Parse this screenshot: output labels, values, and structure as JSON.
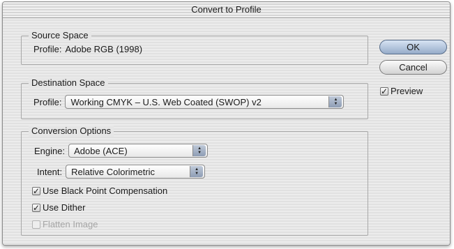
{
  "dialog": {
    "title": "Convert to Profile"
  },
  "source": {
    "title": "Source Space",
    "profile_label": "Profile:",
    "profile_value": "Adobe RGB (1998)"
  },
  "destination": {
    "title": "Destination Space",
    "profile_label": "Profile:",
    "profile_value": "Working CMYK – U.S. Web Coated (SWOP) v2"
  },
  "conversion": {
    "title": "Conversion Options",
    "engine_label": "Engine:",
    "engine_value": "Adobe (ACE)",
    "intent_label": "Intent:",
    "intent_value": "Relative Colorimetric",
    "black_point_label": "Use Black Point Compensation",
    "black_point_checked": true,
    "dither_label": "Use Dither",
    "dither_checked": true,
    "flatten_label": "Flatten Image",
    "flatten_checked": false,
    "flatten_enabled": false
  },
  "buttons": {
    "ok": "OK",
    "cancel": "Cancel"
  },
  "preview": {
    "label": "Preview",
    "checked": true
  },
  "icons": {
    "check": "✓",
    "popup_arrows": "updown-arrows-icon"
  },
  "colors": {
    "default_button": "#96acc9",
    "dialog_bg": "#e4e4e4"
  }
}
